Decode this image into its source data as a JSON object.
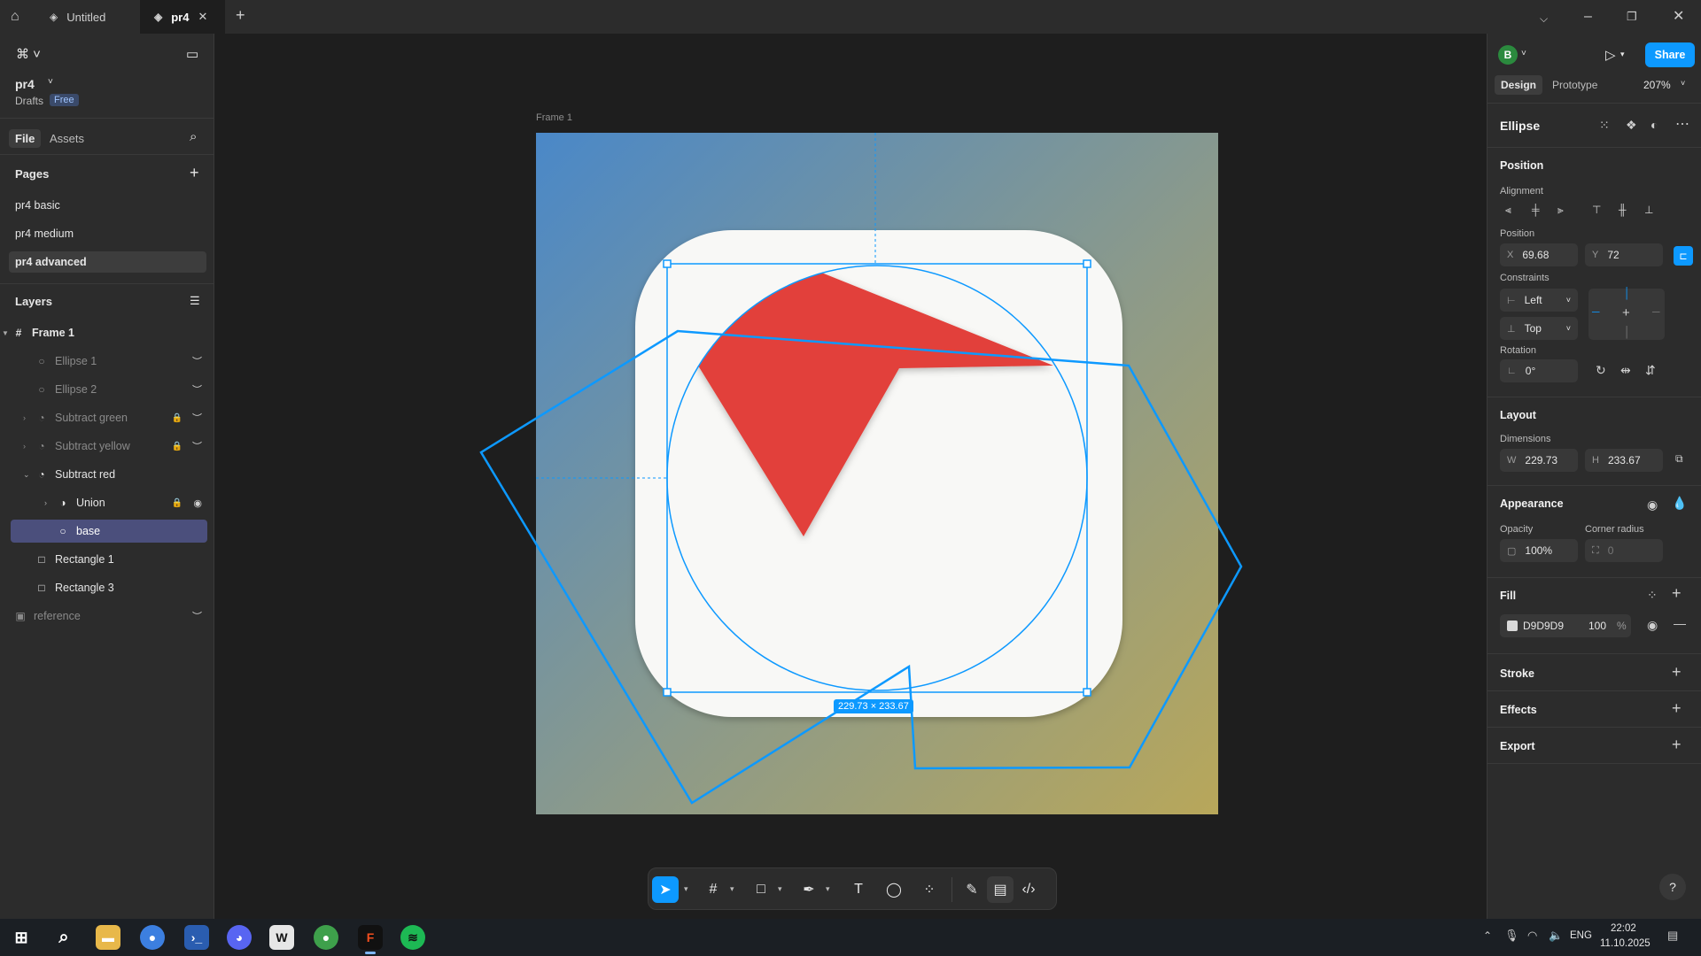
{
  "titlebar": {
    "tabs": [
      {
        "label": "Untitled"
      },
      {
        "label": "pr4"
      }
    ]
  },
  "left_panel": {
    "file_name": "pr4",
    "location": "Drafts",
    "plan_badge": "Free",
    "tabs": {
      "file": "File",
      "assets": "Assets"
    },
    "pages_heading": "Pages",
    "pages": [
      {
        "label": "pr4 basic"
      },
      {
        "label": "pr4 medium"
      },
      {
        "label": "pr4 advanced"
      }
    ],
    "layers_heading": "Layers",
    "layers": [
      {
        "label": "Frame 1"
      },
      {
        "label": "Ellipse 1"
      },
      {
        "label": "Ellipse 2"
      },
      {
        "label": "Subtract green"
      },
      {
        "label": "Subtract yellow"
      },
      {
        "label": "Subtract red"
      },
      {
        "label": "Union"
      },
      {
        "label": "base"
      },
      {
        "label": "Rectangle 1"
      },
      {
        "label": "Rectangle 3"
      },
      {
        "label": "reference"
      }
    ]
  },
  "canvas": {
    "frame_label": "Frame 1",
    "size_badge": "229.73 × 233.67",
    "colors": {
      "red_sector": "#e2403a",
      "selection": "#0d99ff",
      "base": "#f8f8f6"
    }
  },
  "right_panel": {
    "avatar_initial": "B",
    "share_label": "Share",
    "tabs": {
      "design": "Design",
      "prototype": "Prototype"
    },
    "zoom": "207%",
    "layer_type": "Ellipse",
    "position_heading": "Position",
    "alignment_label": "Alignment",
    "position_label": "Position",
    "x_prefix": "X",
    "x_value": "69.68",
    "y_prefix": "Y",
    "y_value": "72",
    "constraints_label": "Constraints",
    "constraint_h": "Left",
    "constraint_v": "Top",
    "rotation_label": "Rotation",
    "rotation_value": "0°",
    "layout_heading": "Layout",
    "dimensions_label": "Dimensions",
    "w_prefix": "W",
    "w_value": "229.73",
    "h_prefix": "H",
    "h_value": "233.67",
    "appearance_heading": "Appearance",
    "opacity_label": "Opacity",
    "opacity_value": "100%",
    "corner_radius_label": "Corner radius",
    "corner_radius_value": "0",
    "fill_heading": "Fill",
    "fill_hex": "D9D9D9",
    "fill_opacity": "100",
    "fill_percent": "%",
    "stroke_heading": "Stroke",
    "effects_heading": "Effects",
    "export_heading": "Export",
    "help": "?"
  },
  "taskbar": {
    "language": "ENG",
    "time": "22:02",
    "date": "11.10.2025"
  }
}
